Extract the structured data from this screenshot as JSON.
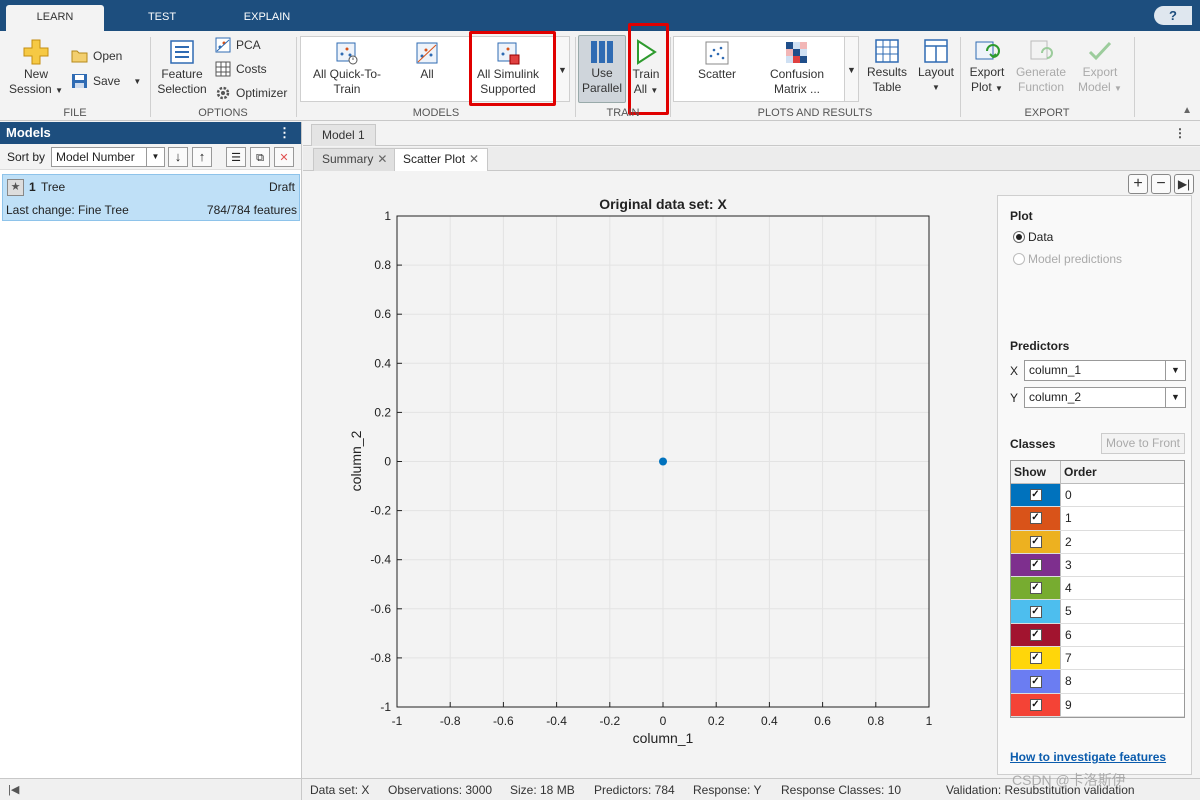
{
  "tabs": [
    "LEARN",
    "TEST",
    "EXPLAIN"
  ],
  "help_label": "?",
  "ribbon": {
    "file": {
      "group_label": "FILE",
      "new_session": [
        "New",
        "Session"
      ],
      "open": "Open",
      "save": "Save"
    },
    "options": {
      "group_label": "OPTIONS",
      "feature_selection": [
        "Feature",
        "Selection"
      ],
      "pca": "PCA",
      "costs": "Costs",
      "optimizer": "Optimizer"
    },
    "models": {
      "group_label": "MODELS",
      "items": [
        [
          "All Quick-To-",
          "Train"
        ],
        [
          "All",
          ""
        ],
        [
          "All Simulink",
          "Supported"
        ]
      ]
    },
    "train": {
      "group_label": "TRAIN",
      "use_parallel": [
        "Use",
        "Parallel"
      ],
      "train_all": [
        "Train",
        "All"
      ]
    },
    "plots": {
      "group_label": "PLOTS AND RESULTS",
      "scatter": "Scatter",
      "confusion_matrix": [
        "Confusion",
        "Matrix ..."
      ],
      "results_table": [
        "Results",
        "Table"
      ],
      "layout": "Layout"
    },
    "export": {
      "group_label": "EXPORT",
      "export_plot": [
        "Export",
        "Plot"
      ],
      "generate_function": [
        "Generate",
        "Function"
      ],
      "export_model": [
        "Export",
        "Model"
      ]
    }
  },
  "models_panel": {
    "title": "Models",
    "sort_label": "Sort by",
    "sort_value": "Model Number",
    "model": {
      "number": "1",
      "name": "Tree",
      "status": "Draft",
      "last_change": "Last change: Fine Tree",
      "features": "784/784 features"
    }
  },
  "doc_tab": "Model 1",
  "sub_tabs": [
    "Summary",
    "Scatter Plot"
  ],
  "chart_data": {
    "type": "scatter",
    "title": "Original data set: X",
    "xlabel": "column_1",
    "ylabel": "column_2",
    "xlim": [
      -1,
      1
    ],
    "ylim": [
      -1,
      1
    ],
    "x_ticks": [
      "-1",
      "-0.8",
      "-0.6",
      "-0.4",
      "-0.2",
      "0",
      "0.2",
      "0.4",
      "0.6",
      "0.8",
      "1"
    ],
    "y_ticks": [
      "-1",
      "-0.8",
      "-0.6",
      "-0.4",
      "-0.2",
      "0",
      "0.2",
      "0.4",
      "0.6",
      "0.8",
      "1"
    ],
    "grid": true,
    "points": [
      {
        "x": 0,
        "y": 0
      }
    ],
    "point_color": "#0072bd"
  },
  "control_panel": {
    "plot_heading": "Plot",
    "plot_options": [
      "Data",
      "Model predictions"
    ],
    "predictors_heading": "Predictors",
    "x_label": "X",
    "x_value": "column_1",
    "y_label": "Y",
    "y_value": "column_2",
    "classes_heading": "Classes",
    "move_to_front": "Move to Front",
    "table_headers": [
      "Show",
      "Order"
    ],
    "classes": [
      {
        "order": "0",
        "color": "#0072bd"
      },
      {
        "order": "1",
        "color": "#d95319"
      },
      {
        "order": "2",
        "color": "#edb120"
      },
      {
        "order": "3",
        "color": "#7e2f8e"
      },
      {
        "order": "4",
        "color": "#77ac30"
      },
      {
        "order": "5",
        "color": "#4dbeee"
      },
      {
        "order": "6",
        "color": "#a2142f"
      },
      {
        "order": "7",
        "color": "#ffd60a"
      },
      {
        "order": "8",
        "color": "#6b7df2"
      },
      {
        "order": "9",
        "color": "#f44336"
      }
    ],
    "help_link": "How to investigate features"
  },
  "status_bar": {
    "data_set": "Data set: X",
    "observations": "Observations: 3000",
    "size": "Size: 18 MB",
    "predictors": "Predictors: 784",
    "response": "Response: Y",
    "response_classes": "Response Classes: 10",
    "validation": "Validation: Resubstitution validation"
  },
  "watermark": "CSDN @卡洛斯伊"
}
